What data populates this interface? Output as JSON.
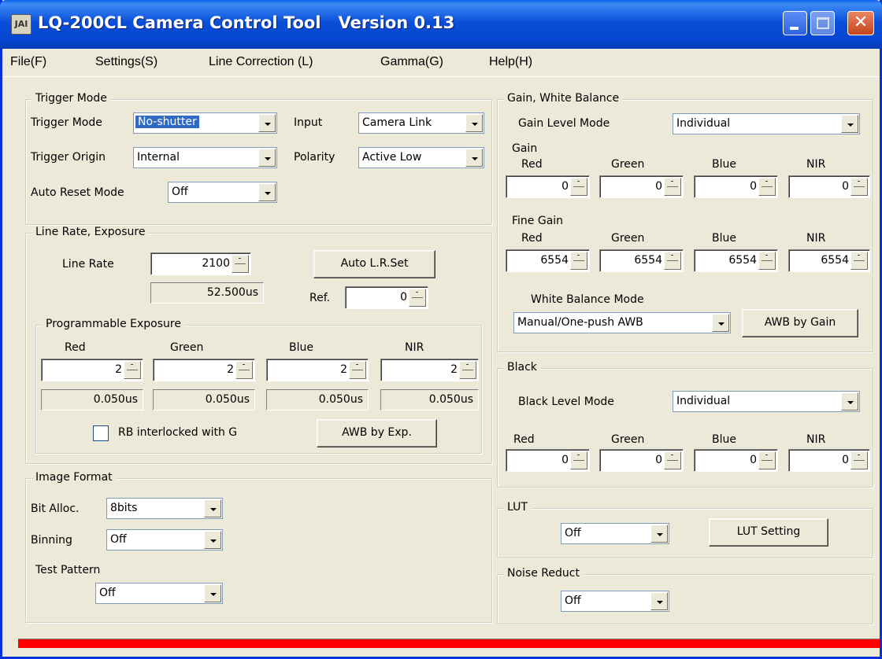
{
  "window": {
    "title": "LQ-200CL Camera Control Tool   Version 0.13",
    "icon_label": "JAI"
  },
  "menubar": {
    "file": "File(F)",
    "settings": "Settings(S)",
    "line_correction": "Line Correction (L)",
    "gamma": "Gamma(G)",
    "help": "Help(H)"
  },
  "trigger": {
    "group_title": "Trigger Mode",
    "mode_label": "Trigger Mode",
    "mode_value": "No-shutter",
    "origin_label": "Trigger Origin",
    "origin_value": "Internal",
    "auto_reset_label": "Auto Reset Mode",
    "auto_reset_value": "Off",
    "input_label": "Input",
    "input_value": "Camera Link",
    "polarity_label": "Polarity",
    "polarity_value": "Active Low"
  },
  "line_rate": {
    "group_title": "Line Rate, Exposure",
    "label": "Line Rate",
    "value": "2100",
    "time": "52.500us",
    "auto_button": "Auto L.R.Set",
    "ref_label": "Ref.",
    "ref_value": "0"
  },
  "prog_exposure": {
    "group_title": "Programmable Exposure",
    "channels": [
      {
        "name": "Red",
        "value": "2",
        "time": "0.050us"
      },
      {
        "name": "Green",
        "value": "2",
        "time": "0.050us"
      },
      {
        "name": "Blue",
        "value": "2",
        "time": "0.050us"
      },
      {
        "name": "NIR",
        "value": "2",
        "time": "0.050us"
      }
    ],
    "rb_checkbox_label": "RB interlocked with G",
    "awb_button": "AWB by Exp."
  },
  "image_format": {
    "group_title": "Image Format",
    "bit_alloc_label": "Bit Alloc.",
    "bit_alloc_value": "8bits",
    "binning_label": "Binning",
    "binning_value": "Off",
    "test_pattern_label": "Test Pattern",
    "test_pattern_value": "Off"
  },
  "gain": {
    "group_title": "Gain, White Balance",
    "level_mode_label": "Gain Level Mode",
    "level_mode_value": "Individual",
    "gain_label": "Gain",
    "gain_channels": [
      {
        "name": "Red",
        "value": "0"
      },
      {
        "name": "Green",
        "value": "0"
      },
      {
        "name": "Blue",
        "value": "0"
      },
      {
        "name": "NIR",
        "value": "0"
      }
    ],
    "fine_label": "Fine Gain",
    "fine_channels": [
      {
        "name": "Red",
        "value": "6554"
      },
      {
        "name": "Green",
        "value": "6554"
      },
      {
        "name": "Blue",
        "value": "6554"
      },
      {
        "name": "NIR",
        "value": "6554"
      }
    ],
    "wb_mode_label": "White Balance Mode",
    "wb_mode_value": "Manual/One-push AWB",
    "awb_button": "AWB by Gain"
  },
  "black": {
    "group_title": "Black",
    "level_mode_label": "Black Level Mode",
    "level_mode_value": "Individual",
    "channels": [
      {
        "name": "Red",
        "value": "0"
      },
      {
        "name": "Green",
        "value": "0"
      },
      {
        "name": "Blue",
        "value": "0"
      },
      {
        "name": "NIR",
        "value": "0"
      }
    ]
  },
  "lut": {
    "group_title": "LUT",
    "value": "Off",
    "button": "LUT Setting"
  },
  "noise": {
    "group_title": "Noise Reduct",
    "value": "Off"
  },
  "status": {
    "bar_color": "#ff0000"
  }
}
